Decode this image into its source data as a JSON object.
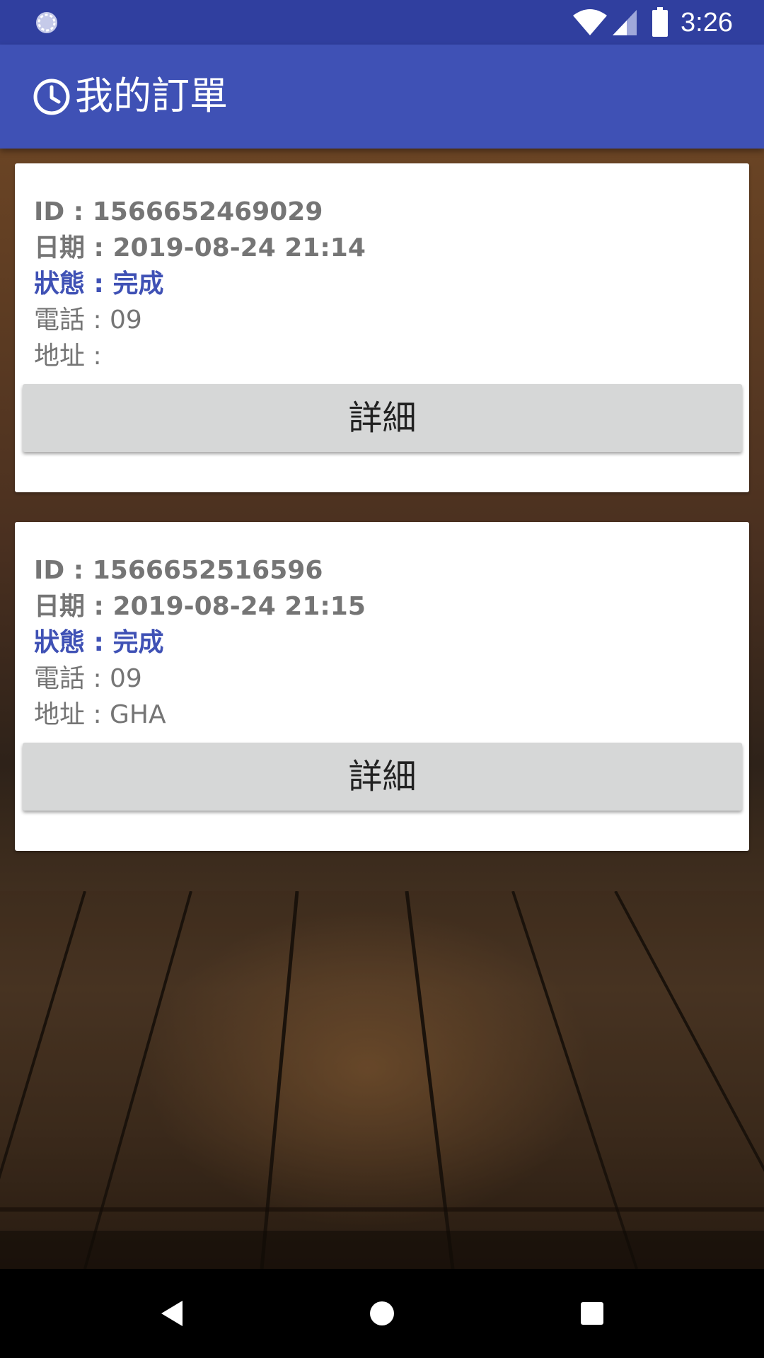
{
  "status_bar": {
    "time": "3:26",
    "icons": [
      "sync-icon",
      "wifi-icon",
      "signal-icon",
      "battery-icon"
    ]
  },
  "app_bar": {
    "icon": "clock-icon",
    "title": "我的訂單"
  },
  "orders": [
    {
      "id_line": "ID : 1566652469029",
      "date_line": "日期 : 2019-08-24 21:14",
      "status_line": "狀態 : 完成",
      "phone_line": "電話 : 09",
      "address_line": "地址 :",
      "button_label": "詳細"
    },
    {
      "id_line": "ID : 1566652516596",
      "date_line": "日期 : 2019-08-24 21:15",
      "status_line": "狀態 : 完成",
      "phone_line": "電話 : 09",
      "address_line": "地址 : GHA",
      "button_label": "詳細"
    }
  ],
  "colors": {
    "status_bar": "#303f9f",
    "app_bar": "#3f51b5",
    "status_text": "#3f51b5",
    "body_text": "#757575",
    "button_bg": "#d6d7d7"
  },
  "nav_bar": {
    "icons": [
      "back-icon",
      "home-icon",
      "recents-icon"
    ]
  }
}
